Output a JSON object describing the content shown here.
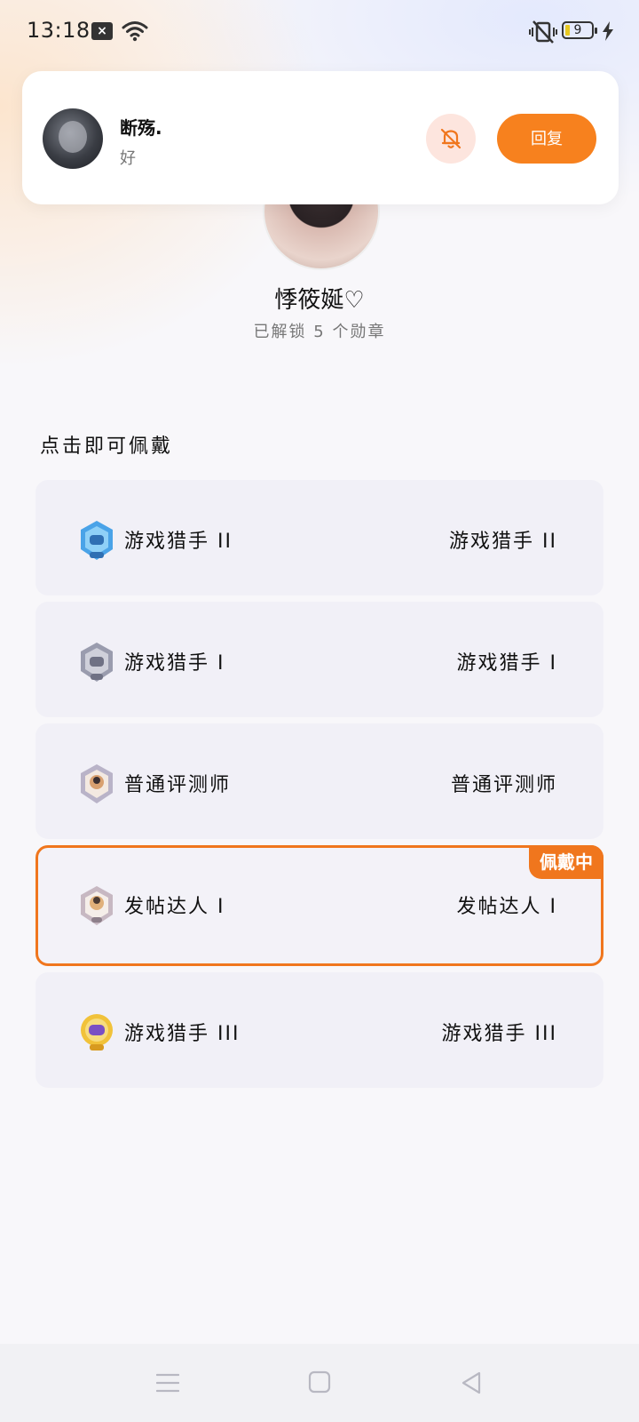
{
  "status_bar": {
    "time": "13:18",
    "battery": "9",
    "icons": [
      "notification-icon",
      "wifi-icon",
      "vibrate-off-icon",
      "battery-icon",
      "charging-icon"
    ]
  },
  "notification": {
    "name": "断殇.",
    "message": "好",
    "mute_icon": "bell-off-icon",
    "reply_label": "回复"
  },
  "profile": {
    "name": "悸筱娫♡",
    "subtitle": "已解锁 5 个勋章"
  },
  "section_title": "点击即可佩戴",
  "badges": [
    {
      "name": "游戏猎手 II",
      "desc": "游戏猎手 II",
      "icon": "game-hunter-2-badge-icon",
      "color": "#4aa3e8"
    },
    {
      "name": "游戏猎手 I",
      "desc": "游戏猎手 I",
      "icon": "game-hunter-1-badge-icon",
      "color": "#9a9cae"
    },
    {
      "name": "普通评测师",
      "desc": "普通评测师",
      "icon": "reviewer-badge-icon",
      "color": "#b9b3c8"
    },
    {
      "name": "发帖达人 I",
      "desc": "发帖达人 I",
      "icon": "poster-badge-icon",
      "color": "#c7b8c2",
      "wearing": true,
      "wearing_label": "佩戴中"
    },
    {
      "name": "游戏猎手 III",
      "desc": "游戏猎手 III",
      "icon": "game-hunter-3-badge-icon",
      "color": "#f1c23a"
    }
  ],
  "nav": {
    "icons": [
      "menu-icon",
      "home-icon",
      "back-icon"
    ]
  },
  "colors": {
    "accent": "#f0761d",
    "card_bg": "#f1f0f7"
  }
}
